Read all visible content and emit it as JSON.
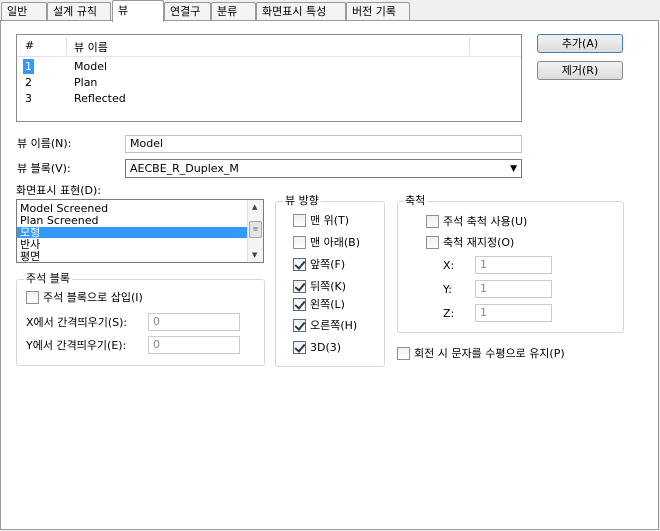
{
  "tabs": [
    "일반",
    "설계 규칙",
    "뷰",
    "연결구",
    "분류",
    "화면표시 특성",
    "버전 기록"
  ],
  "views_list": {
    "headers": [
      "#",
      "뷰 이름"
    ],
    "rows": [
      {
        "num": "1",
        "name": "Model"
      },
      {
        "num": "2",
        "name": "Plan"
      },
      {
        "num": "3",
        "name": "Reflected"
      }
    ]
  },
  "buttons": {
    "add": "추가(A)",
    "remove": "제거(R)"
  },
  "view_name": {
    "label": "뷰 이름(N):",
    "value": "Model"
  },
  "view_block": {
    "label": "뷰 블록(V):",
    "value": "AECBE_R_Duplex_M"
  },
  "display_rep": {
    "label": "화면표시 표현(D):",
    "items": [
      "Model Screened",
      "Plan Screened",
      "모형",
      "반사",
      "평면"
    ],
    "selected_index": 2
  },
  "annotation_block": {
    "title": "주석 블록",
    "insert_label": "주석 블록으로 삽입(I)",
    "insert_checked": false,
    "x_spacing_label": "X에서 간격띄우기(S):",
    "x_spacing_value": "0",
    "y_spacing_label": "Y에서 간격띄우기(E):",
    "y_spacing_value": "0"
  },
  "view_direction": {
    "title": "뷰 방향",
    "options": [
      {
        "label": "맨 위(T)",
        "checked": false
      },
      {
        "label": "맨 아래(B)",
        "checked": false
      },
      {
        "label": "앞쪽(F)",
        "checked": true
      },
      {
        "label": "뒤쪽(K)",
        "checked": true
      },
      {
        "label": "왼쪽(L)",
        "checked": true
      },
      {
        "label": "오른쪽(H)",
        "checked": true
      },
      {
        "label": "3D(3)",
        "checked": true
      }
    ]
  },
  "scale": {
    "title": "축척",
    "use_annotation_label": "주석 축척 사용(U)",
    "use_annotation_checked": false,
    "rescale_label": "축척 재지정(O)",
    "rescale_checked": false,
    "x_label": "X:",
    "x_value": "1",
    "y_label": "Y:",
    "y_value": "1",
    "z_label": "Z:",
    "z_value": "1"
  },
  "keep_text_horizontal": {
    "label": "회전 시 문자를 수평으로 유지(P)",
    "checked": false
  }
}
